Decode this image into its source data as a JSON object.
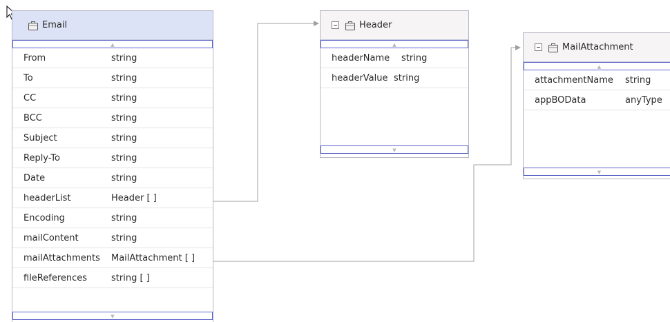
{
  "email": {
    "title": "Email",
    "fields": [
      {
        "name": "From",
        "type": "string"
      },
      {
        "name": "To",
        "type": "string"
      },
      {
        "name": "CC",
        "type": "string"
      },
      {
        "name": "BCC",
        "type": "string"
      },
      {
        "name": "Subject",
        "type": "string"
      },
      {
        "name": "Reply-To",
        "type": "string"
      },
      {
        "name": "Date",
        "type": "string"
      },
      {
        "name": "headerList",
        "type": "Header [ ]"
      },
      {
        "name": "Encoding",
        "type": "string"
      },
      {
        "name": "mailContent",
        "type": "string"
      },
      {
        "name": "mailAttachments",
        "type": "MailAttachment [ ]"
      },
      {
        "name": "fileReferences",
        "type": "string [ ]"
      }
    ]
  },
  "header": {
    "title": "Header",
    "fields": [
      {
        "name": "headerName",
        "type": "string"
      },
      {
        "name": "headerValue",
        "type": "string"
      }
    ]
  },
  "mail_attachment": {
    "title": "MailAttachment",
    "fields": [
      {
        "name": "attachmentName",
        "type": "string"
      },
      {
        "name": "appBOData",
        "type": "anyType"
      }
    ]
  },
  "icons": {
    "cursor": "mouse-pointer-icon",
    "business_object": "business-object-icon",
    "collapse": "collapse-minus-icon",
    "scroll_up": "scroll-up-arrow-icon",
    "scroll_down": "scroll-down-arrow-icon"
  },
  "colors": {
    "email_header_bg": "#dde3f6",
    "other_header_bg": "#f6f4f4",
    "scroll_border": "#5a64c8",
    "connector": "#a0a0a0"
  }
}
